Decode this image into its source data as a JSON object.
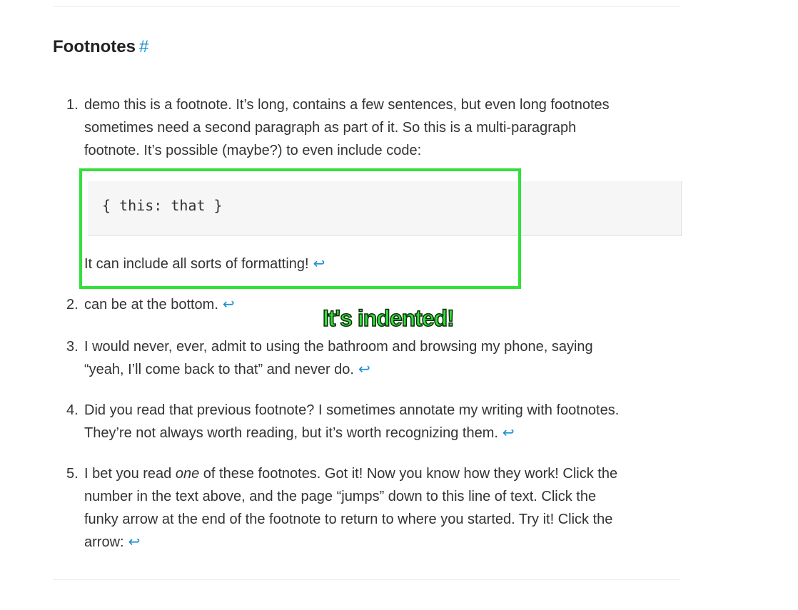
{
  "section": {
    "title": "Footnotes",
    "anchor": "#"
  },
  "backref_symbol": "↩",
  "footnotes": [
    {
      "number": "1.",
      "lines": [
        "demo this is a footnote. It’s long, contains a few sentences, but even long footnotes",
        "sometimes need a second paragraph as part of it. So this is a multi-paragraph",
        "footnote. It’s possible (maybe?) to even include code:"
      ],
      "code": "{ this: that }",
      "extra_paragraph": "It can include all sorts of formatting!"
    },
    {
      "number": "2.",
      "lines": [
        "can be at the bottom."
      ]
    },
    {
      "number": "3.",
      "lines": [
        "I would never, ever, admit to using the bathroom and browsing my phone, saying",
        "“yeah, I’ll come back to that” and never do."
      ]
    },
    {
      "number": "4.",
      "lines": [
        "Did you read that previous footnote? I sometimes annotate my writing with footnotes.",
        "They’re not always worth reading, but it’s worth recognizing them."
      ]
    },
    {
      "number": "5.",
      "line1_before": "I bet you read ",
      "line1_em": "one",
      "line1_after": " of these footnotes. Got it! Now you know how they work! Click the",
      "lines_rest": [
        "number in the text above, and the page “jumps” down to this line of text. Click the",
        "funky arrow at the end of the footnote to return to where you started. Try it! Click the",
        "arrow:"
      ]
    }
  ],
  "annotation": {
    "text": "It's indented!",
    "color": "#33e03a"
  },
  "colors": {
    "link": "#1a8fd0",
    "text": "#333333",
    "code_bg": "#f6f6f7"
  }
}
